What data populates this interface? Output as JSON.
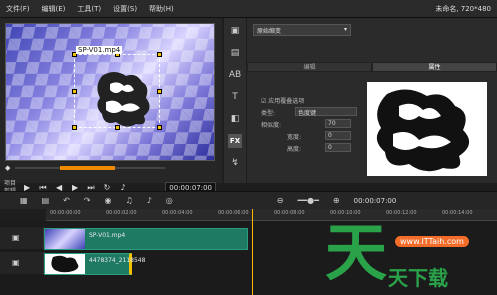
{
  "menu": {
    "items": [
      "文件(F)",
      "编辑(E)",
      "工具(T)",
      "设置(S)",
      "帮助(H)"
    ],
    "project_title": "未命名, 720*480"
  },
  "preview": {
    "clip_title": "SP-V01.mp4"
  },
  "transport": {
    "labels": [
      "项目",
      "剪辑"
    ],
    "timecode": "00:00:07:00"
  },
  "right_panel": {
    "preset_dropdown": "原始缩变",
    "tabs": [
      "编辑",
      "属性"
    ],
    "properties": {
      "row1": "应用覆叠选项",
      "type_label": "类型:",
      "type_value": "色度键",
      "similarity_label": "相似度:",
      "similarity_value": "70",
      "width_label": "宽度:",
      "width_value": "0",
      "height_label": "高度:",
      "height_value": "0"
    }
  },
  "timeline": {
    "timecode": "00:00:07:00",
    "ruler_ticks": [
      "00:00:00:00",
      "00:00:02:00",
      "00:00:04:00",
      "00:00:06:00",
      "00:00:08:00",
      "00:00:10:00",
      "00:00:12:00",
      "00:00:14:00"
    ],
    "clips": [
      "SP-V01.mp4",
      "4478374_2118548"
    ]
  },
  "watermark": {
    "logo_text": "天",
    "url": "www.ITTaih.com",
    "brand": "天下载"
  },
  "colors": {
    "clip_green": "#1e7a63",
    "accent_orange": "#f08a00",
    "handle_yellow": "#f2c200"
  }
}
